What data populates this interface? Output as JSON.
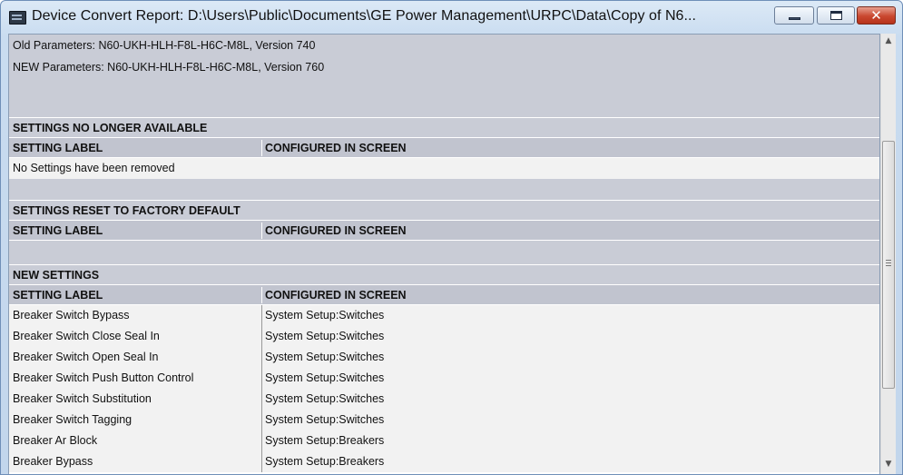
{
  "window": {
    "title": "Device Convert Report: D:\\Users\\Public\\Documents\\GE Power Management\\URPC\\Data\\Copy of N6...",
    "buttons": {
      "minimize": "",
      "maximize": "",
      "close": "✕"
    }
  },
  "report": {
    "old_params": "Old Parameters: N60-UKH-HLH-F8L-H6C-M8L, Version 740",
    "new_params": "NEW Parameters: N60-UKH-HLH-F8L-H6C-M8L, Version 760",
    "col_label": "SETTING LABEL",
    "col_screen": "CONFIGURED IN SCREEN",
    "sections": {
      "removed": {
        "title": "SETTINGS NO LONGER AVAILABLE",
        "message": "No Settings have been removed"
      },
      "reset": {
        "title": "SETTINGS RESET TO FACTORY DEFAULT"
      },
      "new": {
        "title": "NEW SETTINGS",
        "rows": [
          {
            "label": "Breaker Switch Bypass",
            "screen": "System Setup:Switches"
          },
          {
            "label": "Breaker Switch Close Seal In",
            "screen": "System Setup:Switches"
          },
          {
            "label": "Breaker Switch Open Seal In",
            "screen": "System Setup:Switches"
          },
          {
            "label": "Breaker Switch Push Button Control",
            "screen": "System Setup:Switches"
          },
          {
            "label": "Breaker Switch Substitution",
            "screen": "System Setup:Switches"
          },
          {
            "label": "Breaker Switch Tagging",
            "screen": "System Setup:Switches"
          },
          {
            "label": "Breaker Ar Block",
            "screen": "System Setup:Breakers"
          },
          {
            "label": "Breaker Bypass",
            "screen": "System Setup:Breakers"
          }
        ]
      }
    }
  },
  "scrollbar": {
    "up_arrow": "▲",
    "down_arrow": "▼"
  },
  "colors": {
    "header_gray": "#c1c4cf",
    "section_gray": "#c9ccd6",
    "row_bg": "#f2f2f2",
    "close_red": "#c9472f"
  }
}
